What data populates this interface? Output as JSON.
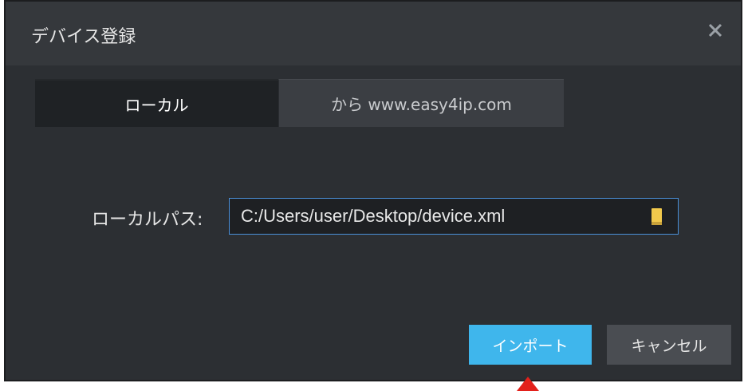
{
  "dialog": {
    "title": "デバイス登録",
    "close_icon": "close-icon"
  },
  "tabs": [
    {
      "label": "ローカル",
      "active": true
    },
    {
      "label": "から www.easy4ip.com",
      "active": false
    }
  ],
  "local_path": {
    "label": "ローカルパス:",
    "value": "C:/Users/user/Desktop/device.xml",
    "browse_icon": "folder-icon"
  },
  "buttons": {
    "import_label": "インポート",
    "cancel_label": "キャンセル"
  },
  "colors": {
    "accent": "#3fb6ec",
    "dialog_bg": "#2c2f33",
    "field_border": "#4a90d9",
    "pointer": "#e3211b"
  }
}
